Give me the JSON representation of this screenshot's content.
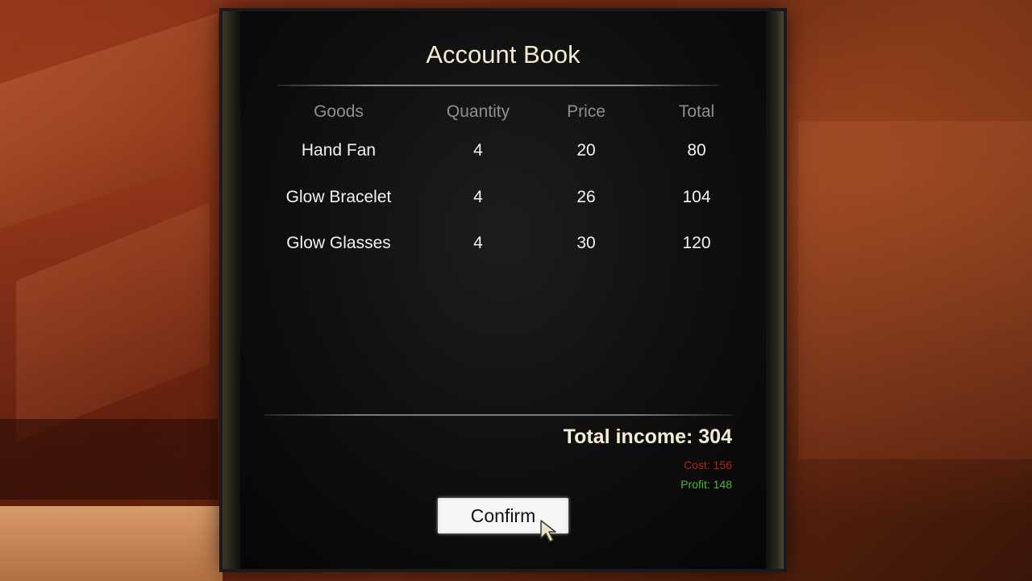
{
  "account_book": {
    "title": "Account Book",
    "columns": [
      "Goods",
      "Quantity",
      "Price",
      "Total"
    ],
    "rows": [
      {
        "goods": "Hand Fan",
        "quantity": "4",
        "price": "20",
        "total": "80"
      },
      {
        "goods": "Glow Bracelet",
        "quantity": "4",
        "price": "26",
        "total": "104"
      },
      {
        "goods": "Glow Glasses",
        "quantity": "4",
        "price": "30",
        "total": "120"
      }
    ],
    "total_income": "Total income: 304",
    "cost": "Cost: 156",
    "profit": "Profit: 148",
    "confirm_label": "Confirm"
  },
  "colors": {
    "title": "#f3ecd0",
    "header": "#8f8f8f",
    "cost": "#b3201c",
    "profit": "#4fb43b",
    "button_bg": "#f6f6f6"
  },
  "icons": {
    "cursor": "arrow-cursor-icon"
  }
}
